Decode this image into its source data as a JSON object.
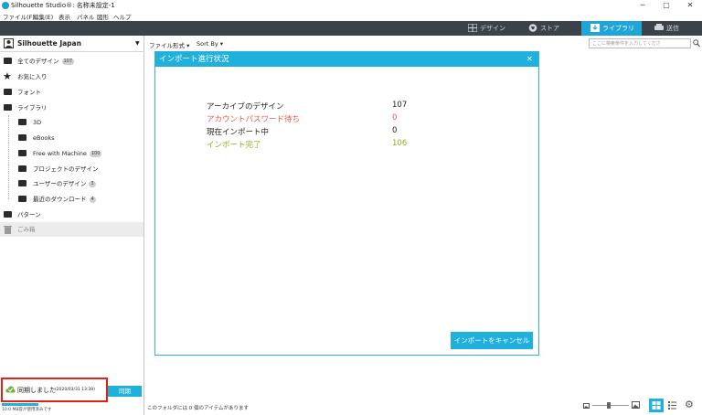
{
  "window": {
    "title": "Silhouette Studio®: 名称未設定-1",
    "minimize": "─",
    "maximize": "▢",
    "close": "✕"
  },
  "menu": [
    "ファイル(F)",
    "編集(E)",
    "表示",
    "パネル",
    "図形",
    "ヘルプ"
  ],
  "nav": {
    "tabs": [
      {
        "label": "デザイン",
        "icon": "grid-icon"
      },
      {
        "label": "ストア",
        "icon": "store-icon"
      },
      {
        "label": "ライブラリ",
        "icon": "library-icon",
        "active": true
      },
      {
        "label": "送信",
        "icon": "send-icon"
      }
    ],
    "active_color": "#1fa6d8",
    "bar_color": "#3b4249"
  },
  "sidebar": {
    "account": "Silhouette Japan",
    "items": [
      {
        "label": "全てのデザイン",
        "badge": "107",
        "icon": "folder-icon",
        "indent": 0
      },
      {
        "label": "お気に入り",
        "badge": "",
        "icon": "star-icon",
        "indent": 0
      },
      {
        "label": "フォント",
        "badge": "",
        "icon": "folder-icon",
        "indent": 0
      },
      {
        "label": "ライブラリ",
        "badge": "",
        "icon": "folder-open-icon",
        "indent": 0
      },
      {
        "label": "3D",
        "badge": "",
        "icon": "folder-icon",
        "indent": 1
      },
      {
        "label": "eBooks",
        "badge": "",
        "icon": "folder-icon",
        "indent": 1
      },
      {
        "label": "Free with Machine",
        "badge": "100",
        "icon": "folder-plus-icon",
        "indent": 1
      },
      {
        "label": "プロジェクトのデザイン",
        "badge": "",
        "icon": "folder-icon",
        "indent": 1
      },
      {
        "label": "ユーザーのデザイン",
        "badge": "3",
        "icon": "folder-icon",
        "indent": 1
      },
      {
        "label": "最近のダウンロード",
        "badge": "4",
        "icon": "folder-icon",
        "indent": 1
      },
      {
        "label": "パターン",
        "badge": "",
        "icon": "folder-icon",
        "indent": 0
      },
      {
        "label": "ごみ箱",
        "badge": "",
        "icon": "trash-icon",
        "indent": 0
      }
    ],
    "sync_label": "同期しました",
    "sync_time": "(2020/03/31 13:39)",
    "sync_button": "同期",
    "storage_text": "10.0 MB容が使用済みです"
  },
  "toolbar": {
    "format_label": "ファイル形式",
    "sort_label": "Sort By",
    "search_placeholder": "ここに検索条件を入力してくださ"
  },
  "dialog": {
    "title": "インポート進行状況",
    "close": "✕",
    "stats": [
      {
        "label": "アーカイブのデザイン",
        "value": "107",
        "color": "#222222"
      },
      {
        "label": "アカウントパスワード待ち",
        "value": "0",
        "color": "#e8554e"
      },
      {
        "label": "現在インポート中",
        "value": "0",
        "color": "#222222"
      },
      {
        "label": "インポート完了",
        "value": "106",
        "color": "#8fae1b"
      }
    ],
    "cancel_label": "インポートをキャンセル"
  },
  "status": {
    "text": "このフォルダには 0 個のアイテムがあります"
  }
}
